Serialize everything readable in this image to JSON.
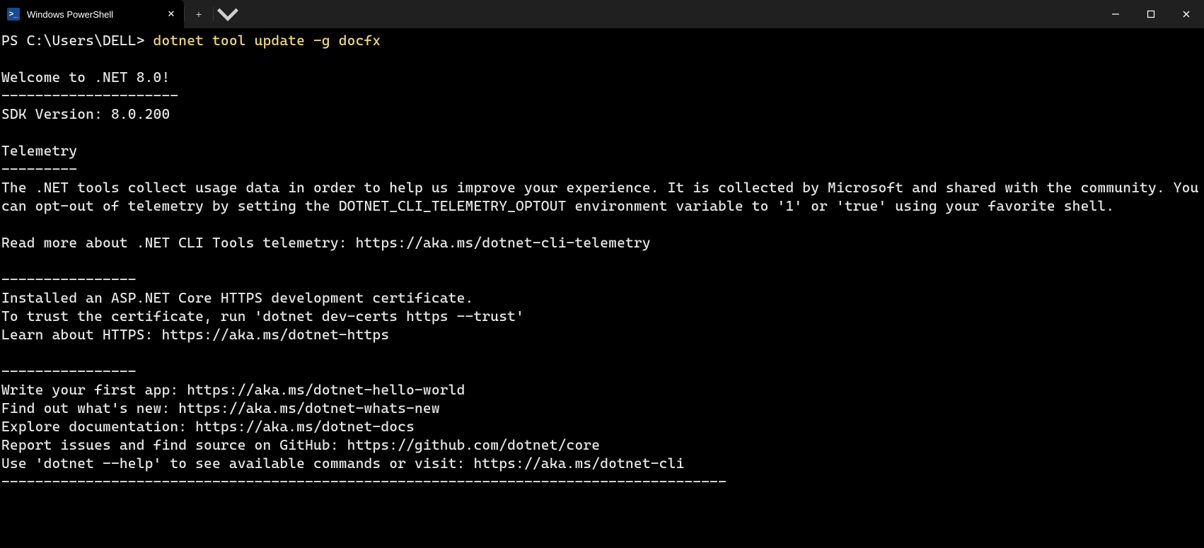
{
  "titlebar": {
    "tab_title": "Windows PowerShell",
    "ps_icon_text": ">_"
  },
  "terminal": {
    "prompt": "PS C:\\Users\\DELL> ",
    "command": "dotnet tool update -g docfx",
    "lines": [
      "",
      "Welcome to .NET 8.0!",
      "---------------------",
      "SDK Version: 8.0.200",
      "",
      "Telemetry",
      "---------",
      "The .NET tools collect usage data in order to help us improve your experience. It is collected by Microsoft and shared with the community. You can opt-out of telemetry by setting the DOTNET_CLI_TELEMETRY_OPTOUT environment variable to '1' or 'true' using your favorite shell.",
      "",
      "Read more about .NET CLI Tools telemetry: https://aka.ms/dotnet-cli-telemetry",
      "",
      "----------------",
      "Installed an ASP.NET Core HTTPS development certificate.",
      "To trust the certificate, run 'dotnet dev-certs https --trust'",
      "Learn about HTTPS: https://aka.ms/dotnet-https",
      "",
      "----------------",
      "Write your first app: https://aka.ms/dotnet-hello-world",
      "Find out what's new: https://aka.ms/dotnet-whats-new",
      "Explore documentation: https://aka.ms/dotnet-docs",
      "Report issues and find source on GitHub: https://github.com/dotnet/core",
      "Use 'dotnet --help' to see available commands or visit: https://aka.ms/dotnet-cli",
      "--------------------------------------------------------------------------------------"
    ]
  }
}
